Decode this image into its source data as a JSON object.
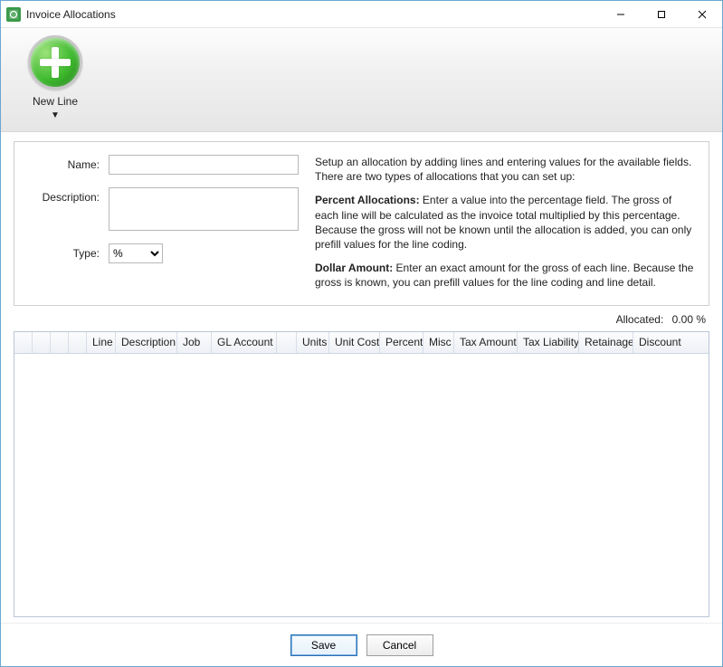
{
  "window": {
    "title": "Invoice Allocations"
  },
  "toolbar": {
    "newline_label": "New Line"
  },
  "form": {
    "name_label": "Name:",
    "name_value": "",
    "desc_label": "Description:",
    "desc_value": "",
    "type_label": "Type:",
    "type_value": "%"
  },
  "help": {
    "intro": "Setup an allocation by adding lines and entering values for the available fields. There are two types of allocations that you can set up:",
    "percent_label": "Percent Allocations:",
    "percent_text": " Enter a value into the percentage field. The gross of each line will be calculated as the invoice total multiplied by this percentage. Because the gross will not be known until the allocation is added, you can only prefill values for the line coding.",
    "dollar_label": "Dollar Amount:",
    "dollar_text": " Enter an exact amount for the gross of each line. Because the gross is known, you can prefill values for the line coding and line detail."
  },
  "allocated": {
    "label": "Allocated:",
    "value": "0.00 %"
  },
  "grid": {
    "columns": [
      "",
      "",
      "",
      "",
      "Line",
      "Description",
      "Job",
      "GL Account",
      "",
      "Units",
      "Unit Cost",
      "Percent",
      "Misc",
      "Tax Amount",
      "Tax Liability",
      "Retainage",
      "Discount"
    ]
  },
  "footer": {
    "save": "Save",
    "cancel": "Cancel"
  }
}
